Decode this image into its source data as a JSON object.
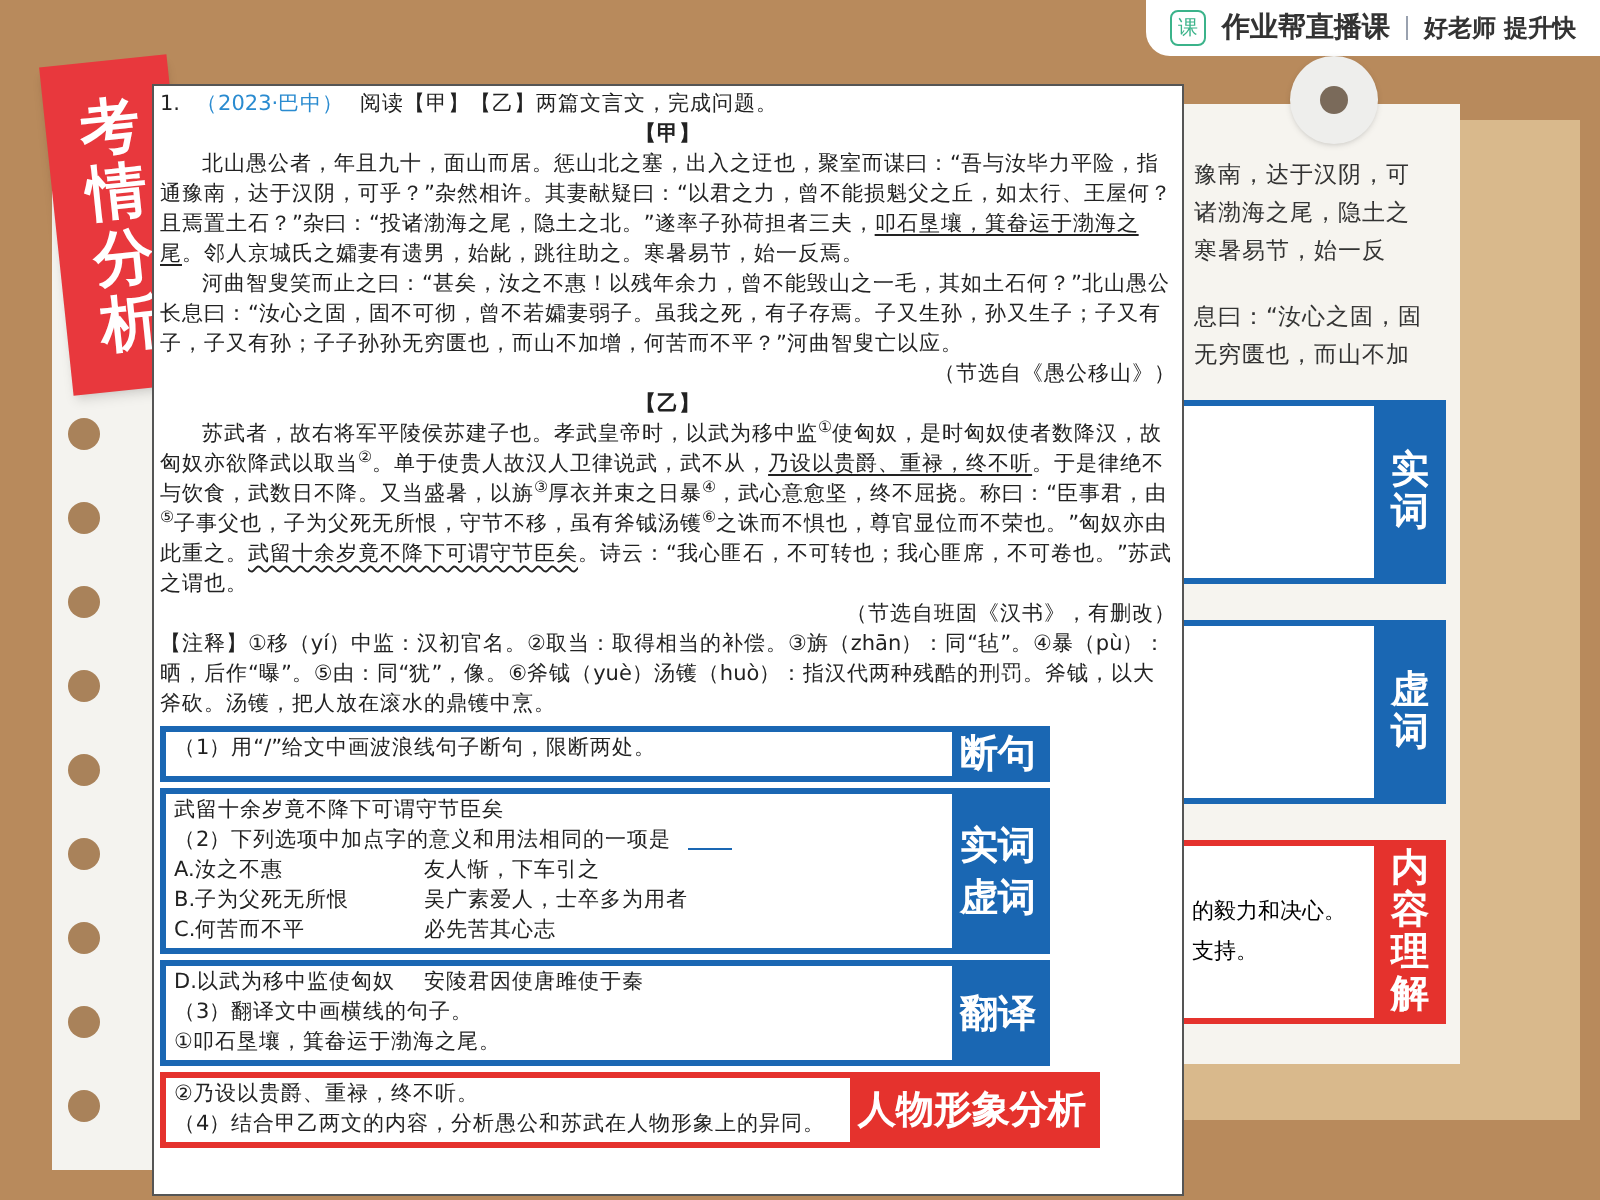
{
  "header": {
    "logo_mark": "课",
    "brand": "作业帮直播课",
    "slogan": "好老师 提升快"
  },
  "ribbon": {
    "text": "考情分析"
  },
  "question": {
    "number": "1.",
    "source": "（2023·巴中）",
    "prompt": "阅读【甲】【乙】两篇文言文，完成问题。"
  },
  "passages": [
    {
      "heading": "【甲】",
      "paragraphs": [
        [
          {
            "text": "北山愚公者，年且九十，面山而居。惩山北之塞，出入之迂也，聚室而谋曰：“吾与汝毕力平险，指通豫南，达于汉阴，可乎？”杂然相许。其妻献疑曰：“以君之力，曾不能损魁父之丘，如太行、王屋何？且焉置土石？”杂曰：“投诸渤海之尾，隐土之北。”遂率子孙荷担者三夫，"
          },
          {
            "text": "叩石垦壤，箕畚运于渤海之尾",
            "underline": true,
            "wavy": false
          },
          {
            "text": "。邻人京城氏之孀妻有遗男，始龀，跳往助之。寒暑易节，始一反焉。"
          }
        ],
        [
          {
            "text": "河曲智叟笑而止之曰：“甚矣，汝之不惠！以残年余力，曾不能毁山之一毛，其如土石何？”北山愚公长息曰：“汝心之固，固不可彻，曾不若孀妻弱子。虽我之死，有子存焉。子又生孙，孙又生子；子又有子，子又有孙；子子孙孙无穷匮也，而山不加增，何苦而不平？”河曲智叟亡以应。"
          }
        ]
      ],
      "citation": "（节选自《愚公移山》）"
    },
    {
      "heading": "【乙】",
      "paragraphs": [
        [
          {
            "text": "苏武者，故右将军平陵侯苏建子也。孝武皇帝时，以武为移中监$^{①}$使匈奴，是时匈奴使者数降汉，故匈奴亦欲降武以取当$^{②}$。单于使贵人故汉人卫律说武，武不从，"
          },
          {
            "text": "乃设以贵爵、重禄，终不听",
            "underline": true,
            "wavy": false
          },
          {
            "text": "。于是律绝不与饮食，武数日不降。又当盛暑，以旃$^{③}$厚衣并束之日暴$^{④}$，武心意愈坚，终不屈挠。称曰：“臣事君，由$^{⑤}$子事父也，子为父死无所恨，守节不移，虽有斧钺汤镬$^{⑥}$之诛而不惧也，尊官显位而不荣也。”匈奴亦由此重之。"
          },
          {
            "text": "武留十余岁竟不降下可谓守节臣矣",
            "underline": true,
            "wavy": true
          },
          {
            "text": "。诗云：“我心匪石，不可转也；我心匪席，不可卷也。”苏武之谓也。"
          }
        ]
      ],
      "citation": "（节选自班固《汉书》，有删改）"
    }
  ],
  "notes": "【注释】①移（yí）中监：汉初官名。②取当：取得相当的补偿。③旃（zhān）：同“毡”。④暴（pù）：晒，后作“曝”。⑤由：同“犹”，像。⑥斧钺（yuè）汤镬（huò）：指汉代两种残酷的刑罚。斧钺，以大斧砍。汤镬，把人放在滚水的鼎镬中烹。",
  "sections": [
    {
      "tags": [
        "断句"
      ],
      "color": "#1a67b3",
      "lines": [
        {
          "kind": "text",
          "text": "（1）用“/”给文中画波浪线句子断句，限断两处。"
        }
      ]
    },
    {
      "tags": [
        "实词",
        "虚词"
      ],
      "color": "#1a67b3",
      "lines": [
        {
          "kind": "text",
          "text": "武留十余岁竟不降下可谓守节臣矣"
        },
        {
          "kind": "text",
          "text": "（2）下列选项中加点字的意义和用法相同的一项是",
          "blank": true
        },
        {
          "kind": "option",
          "left": "A.汝之不惠",
          "right": "友人惭，下车引之"
        },
        {
          "kind": "option",
          "left": "B.子为父死无所恨",
          "right": "吴广素爱人，士卒多为用者"
        },
        {
          "kind": "option",
          "left": "C.何苦而不平",
          "right": "必先苦其心志"
        }
      ]
    },
    {
      "tags": [
        "翻译"
      ],
      "color": "#1a67b3",
      "lines": [
        {
          "kind": "option",
          "left": "D.以武为移中监使匈奴",
          "right": "安陵君因使唐雎使于秦"
        },
        {
          "kind": "text",
          "text": "（3）翻译文中画横线的句子。"
        },
        {
          "kind": "text",
          "text": "①叩石垦壤，箕畚运于渤海之尾。"
        }
      ]
    },
    {
      "tags": [
        "人物形象分析"
      ],
      "color": "#e5322d",
      "lines": [
        {
          "kind": "text",
          "text": "②乃设以贵爵、重禄，终不听。"
        },
        {
          "kind": "text",
          "text": "（4）结合甲乙两文的内容，分析愚公和苏武在人物形象上的异同。"
        }
      ]
    }
  ],
  "back_page": {
    "lines": [
      "豫南，达于汉阴，可",
      "诸渤海之尾，隐土之",
      "寒暑易节，始一反",
      "息曰：“汝心之固，固",
      "无穷匮也，而山不加"
    ],
    "side_tags": [
      {
        "text": "实词",
        "color": "#1a67b3"
      },
      {
        "text": "虚词",
        "color": "#1a67b3"
      },
      {
        "text": "内容理解",
        "color": "#e5322d",
        "lines": [
          "的毅力和决心。",
          "支持。"
        ]
      }
    ]
  }
}
